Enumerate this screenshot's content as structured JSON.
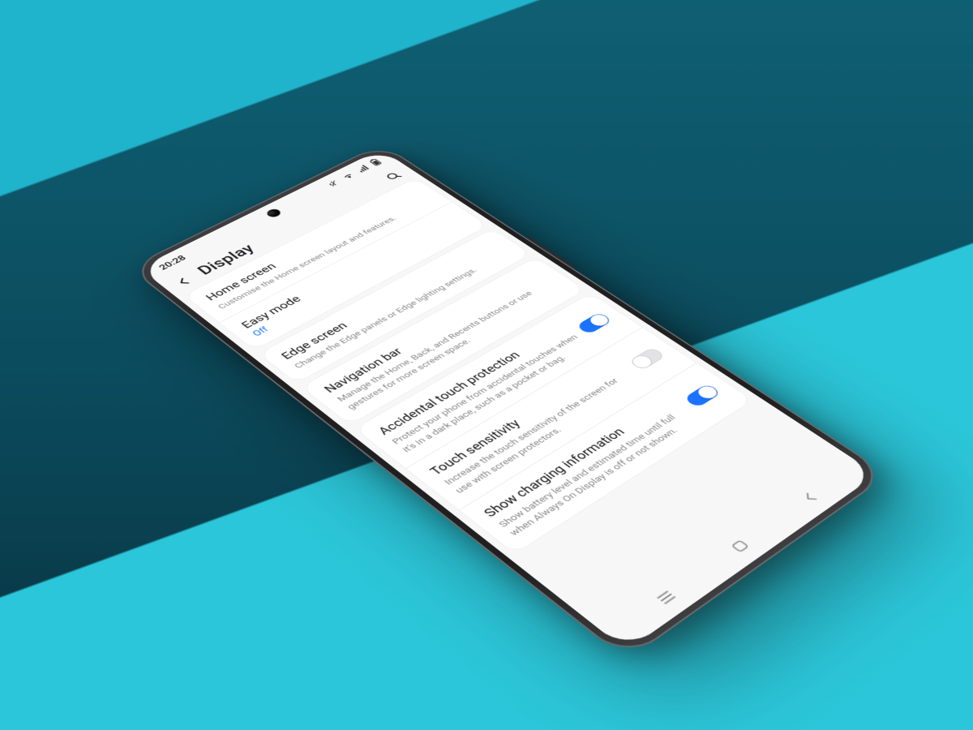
{
  "status": {
    "time": "20:28"
  },
  "header": {
    "title": "Display"
  },
  "groups": [
    {
      "rows": [
        {
          "title": "Home screen",
          "sub": "Customise the Home screen layout and features."
        },
        {
          "title": "Easy mode",
          "value": "Off",
          "valueClass": "blue"
        }
      ]
    },
    {
      "rows": [
        {
          "title": "Edge screen",
          "sub": "Change the Edge panels or Edge lighting settings."
        }
      ]
    },
    {
      "rows": [
        {
          "title": "Navigation bar",
          "sub": "Manage the Home, Back, and Recents buttons or use gestures for more screen space."
        }
      ]
    },
    {
      "rows": [
        {
          "title": "Accidental touch protection",
          "sub": "Protect your phone from accidental touches when it's in a dark place, such as a pocket or bag.",
          "toggle": true,
          "on": true
        },
        {
          "title": "Touch sensitivity",
          "sub": "Increase the touch sensitivity of the screen for use with screen protectors.",
          "toggle": true,
          "on": false
        },
        {
          "title": "Show charging information",
          "sub": "Show battery level and estimated time until full when Always On Display is off or not shown.",
          "toggle": true,
          "on": true
        }
      ]
    }
  ]
}
